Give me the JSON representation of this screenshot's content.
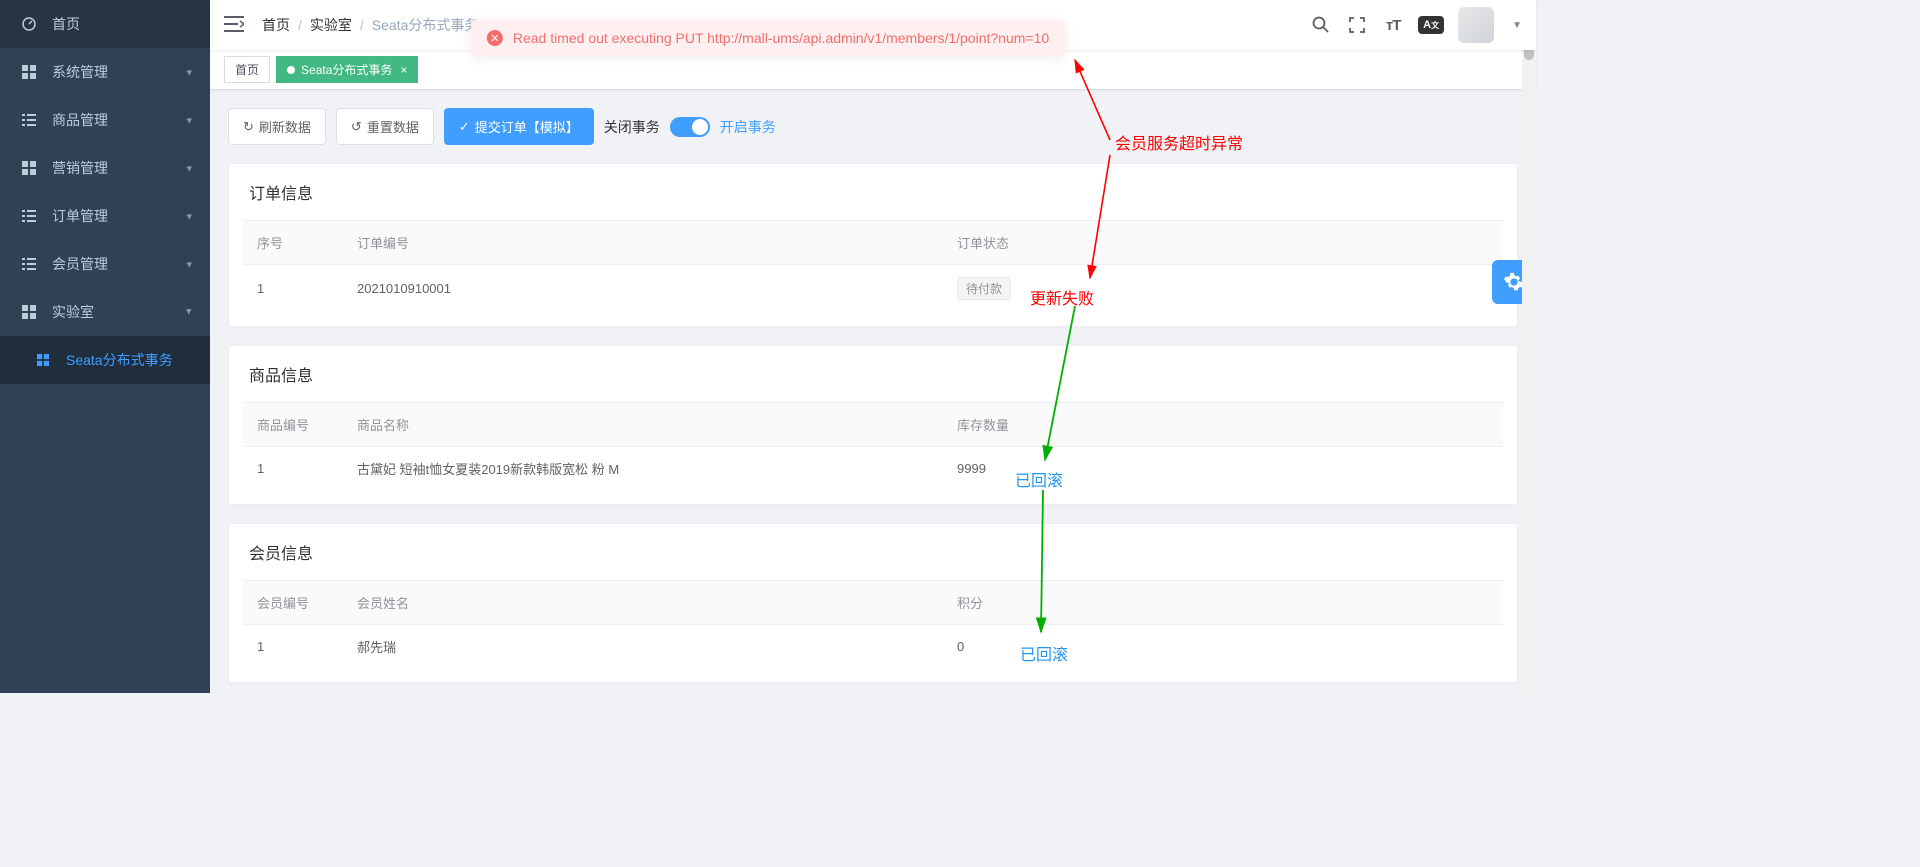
{
  "sidebar": {
    "items": [
      {
        "label": "首页",
        "icon": "dashboard"
      },
      {
        "label": "系统管理",
        "icon": "grid",
        "chev": true
      },
      {
        "label": "商品管理",
        "icon": "list",
        "chev": true
      },
      {
        "label": "营销管理",
        "icon": "grid",
        "chev": true
      },
      {
        "label": "订单管理",
        "icon": "list",
        "chev": true
      },
      {
        "label": "会员管理",
        "icon": "list",
        "chev": true
      },
      {
        "label": "实验室",
        "icon": "grid",
        "chev": true,
        "expanded": true
      }
    ],
    "sub": {
      "label": "Seata分布式事务"
    }
  },
  "breadcrumb": {
    "a": "首页",
    "b": "实验室",
    "c": "Seata分布式事务"
  },
  "alert": {
    "text": "Read timed out executing PUT http://mall-ums/api.admin/v1/members/1/point?num=10"
  },
  "tabs": {
    "home": "首页",
    "active": "Seata分布式事务"
  },
  "toolbar": {
    "refresh": "刷新数据",
    "reset": "重置数据",
    "submit": "提交订单【模拟】",
    "close_tx": "关闭事务",
    "open_tx": "开启事务"
  },
  "order": {
    "title": "订单信息",
    "cols": {
      "no": "序号",
      "id": "订单编号",
      "status": "订单状态"
    },
    "row": {
      "no": "1",
      "id": "2021010910001",
      "status": "待付款"
    }
  },
  "product": {
    "title": "商品信息",
    "cols": {
      "no": "商品编号",
      "name": "商品名称",
      "stock": "库存数量"
    },
    "row": {
      "no": "1",
      "name": "古黛妃 短袖t恤女夏装2019新款韩版宽松 粉 M",
      "stock": "9999"
    }
  },
  "member": {
    "title": "会员信息",
    "cols": {
      "no": "会员编号",
      "name": "会员姓名",
      "points": "积分"
    },
    "row": {
      "no": "1",
      "name": "郝先瑞",
      "points": "0"
    }
  },
  "anno": {
    "timeout": "会员服务超时异常",
    "fail": "更新失败",
    "rolled1": "已回滚",
    "rolled2": "已回滚"
  }
}
